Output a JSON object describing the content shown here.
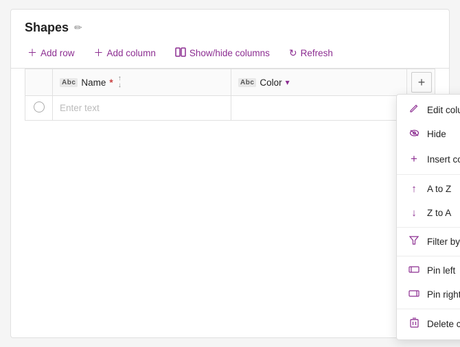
{
  "header": {
    "title": "Shapes",
    "edit_icon": "✏"
  },
  "toolbar": {
    "add_row": "Add row",
    "add_column": "Add column",
    "show_hide": "Show/hide columns",
    "refresh": "Refresh"
  },
  "table": {
    "columns": [
      {
        "id": "name",
        "label": "Name",
        "required": true
      },
      {
        "id": "color",
        "label": "Color",
        "required": false
      }
    ],
    "placeholder": "Enter text",
    "add_col_label": "+"
  },
  "dropdown": {
    "items": [
      {
        "id": "edit-column",
        "label": "Edit column",
        "icon": "✏"
      },
      {
        "id": "hide",
        "label": "Hide",
        "icon": "👁"
      },
      {
        "id": "insert-column",
        "label": "Insert column",
        "icon": "+"
      },
      {
        "id": "a-to-z",
        "label": "A to Z",
        "icon": "↑"
      },
      {
        "id": "z-to-a",
        "label": "Z to A",
        "icon": "↓"
      },
      {
        "id": "filter-by",
        "label": "Filter by",
        "icon": "⊽"
      },
      {
        "id": "pin-left",
        "label": "Pin left",
        "icon": "▱"
      },
      {
        "id": "pin-right",
        "label": "Pin right",
        "icon": "▱"
      },
      {
        "id": "delete-column",
        "label": "Delete column",
        "icon": "🗑"
      }
    ]
  }
}
